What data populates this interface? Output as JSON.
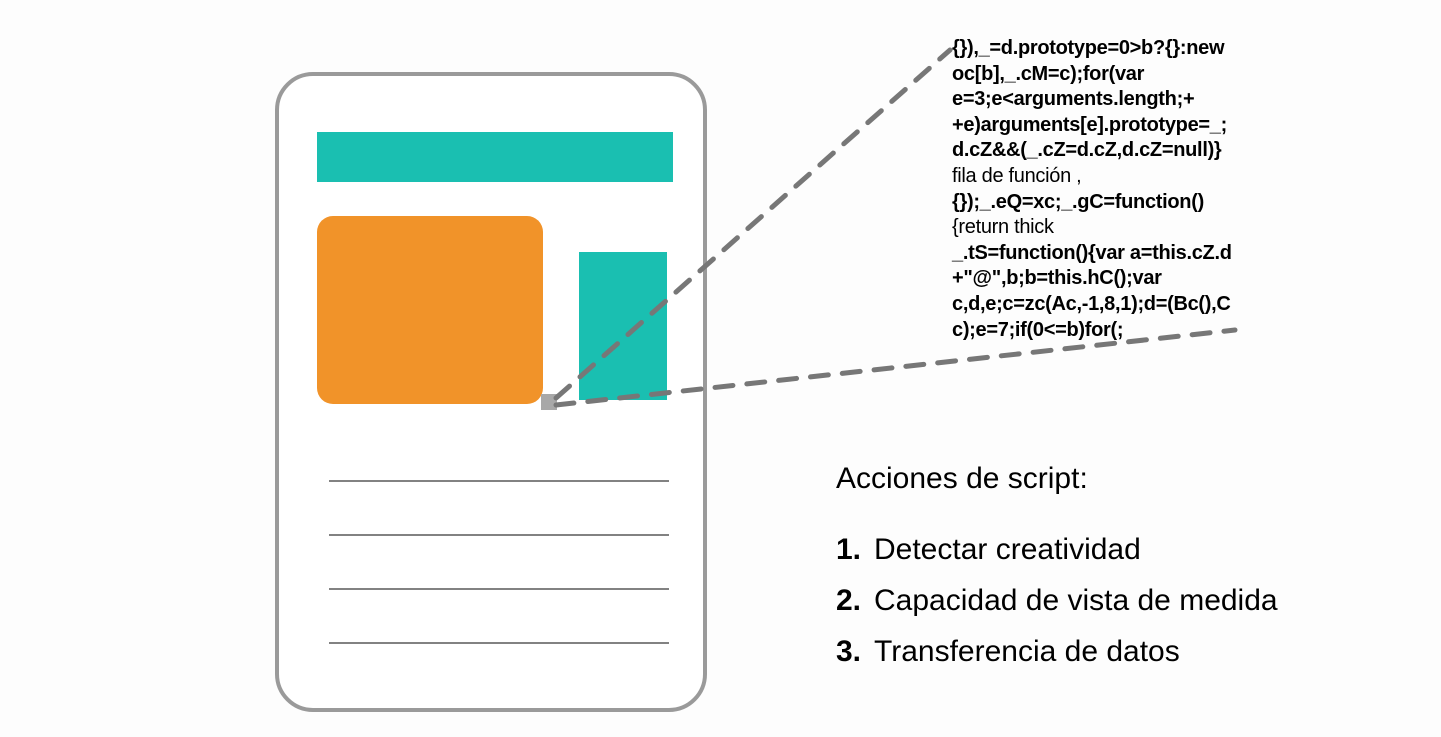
{
  "code": {
    "l1": "{}),_=d.prototype=0>b?{}:new",
    "l2": "oc[b],_.cM=c);for(var",
    "l3": "e=3;e<arguments.length;+",
    "l4": "+e)arguments[e].prototype=_;",
    "l5": "d.cZ&&(_.cZ=d.cZ,d.cZ=null)}",
    "l6": "fila de función ,",
    "l7": "{});_.eQ=xc;_.gC=function()",
    "l8": "{return thick",
    "l9": "_.tS=function(){var a=this.cZ.d",
    "l10": "+\"@\",b;b=this.hC();var",
    "l11": "c,d,e;c=zc(Ac,-1,8,1);d=(Bc(),C",
    "l12": "c);e=7;if(0<=b)for(;"
  },
  "heading": "Acciones de script:",
  "actions": {
    "n1": "1.",
    "t1": "Detectar creatividad",
    "n2": "2.",
    "t2": "Capacidad de vista de medida",
    "n3": "3.",
    "t3": "Transferencia de datos"
  }
}
